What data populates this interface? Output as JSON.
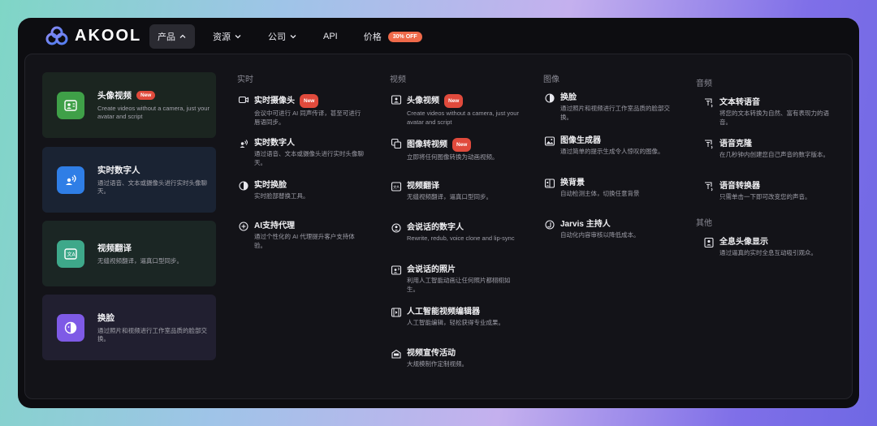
{
  "brand": {
    "name": "AKOOL"
  },
  "nav": {
    "items": [
      {
        "label": "产品",
        "active": true,
        "chevron": true
      },
      {
        "label": "资源",
        "active": false,
        "chevron": true
      },
      {
        "label": "公司",
        "active": false,
        "chevron": true
      },
      {
        "label": "API",
        "active": false,
        "chevron": false
      },
      {
        "label": "价格",
        "active": false,
        "chevron": false
      }
    ],
    "pricing_badge": "30% OFF"
  },
  "feature_cards": [
    {
      "title": "头像视频",
      "badge": "New",
      "desc": "Create videos without a camera, just your avatar and script",
      "color": "#3fa048",
      "bg": "#1b2520",
      "icon": "avatar-video-icon"
    },
    {
      "title": "实时数字人",
      "badge": "",
      "desc": "通过语音、文本或摄像头进行实时头像聊天。",
      "color": "#2f7ee6",
      "bg": "#1a2333",
      "icon": "realtime-avatar-icon"
    },
    {
      "title": "视频翻译",
      "badge": "",
      "desc": "无缝视频翻译，逼真口型同步。",
      "color": "#3ea88a",
      "bg": "#1b2624",
      "icon": "video-translate-icon"
    },
    {
      "title": "换脸",
      "badge": "",
      "desc": "通过照片和视频进行工作室品质的脸部交换。",
      "color": "#7e5ae6",
      "bg": "#211f30",
      "icon": "face-swap-icon"
    }
  ],
  "columns": {
    "realtime": {
      "heading": "实时",
      "items": [
        {
          "title": "实时摄像头",
          "badge": "New",
          "desc": "会议中可进行 AI 同声传译，甚至可进行唇语同步。",
          "icon": "camera-icon"
        },
        {
          "title": "实时数字人",
          "badge": "",
          "desc": "通过语音、文本或摄像头进行实时头像聊天。",
          "icon": "realtime-avatar-icon"
        },
        {
          "title": "实时换脸",
          "badge": "",
          "desc": "实时脸部替换工具。",
          "icon": "face-swap-icon"
        },
        {
          "title": "AI支持代理",
          "badge": "",
          "desc": "通过个性化的 AI 代理提升客户支持体验。",
          "icon": "support-agent-icon"
        }
      ]
    },
    "video": {
      "heading": "视频",
      "items": [
        {
          "title": "头像视频",
          "badge": "New",
          "desc": "Create videos without a camera, just your avatar and script",
          "icon": "avatar-video-icon"
        },
        {
          "title": "图像转视频",
          "badge": "New",
          "desc": "立即将任何图像转换为动画视频。",
          "icon": "image-to-video-icon"
        },
        {
          "title": "视频翻译",
          "badge": "",
          "desc": "无缝视频翻译，逼真口型同步。",
          "icon": "video-translate-icon"
        },
        {
          "title": "会说话的数字人",
          "badge": "",
          "desc": "Rewrite, redub, voice clone and lip-sync",
          "icon": "talking-avatar-icon"
        },
        {
          "title": "会说话的照片",
          "badge": "",
          "desc": "利用人工智能动画让任何照片都栩栩如生。",
          "icon": "talking-photo-icon"
        },
        {
          "title": "人工智能视频编辑器",
          "badge": "",
          "desc": "人工智能编辑，轻松获得专业成果。",
          "icon": "video-editor-icon"
        },
        {
          "title": "视频宣传活动",
          "badge": "",
          "desc": "大规模制作定制视频。",
          "icon": "campaign-icon"
        }
      ]
    },
    "image": {
      "heading": "图像",
      "items": [
        {
          "title": "换脸",
          "badge": "",
          "desc": "通过照片和视频进行工作室品质的脸部交换。",
          "icon": "face-swap-icon"
        },
        {
          "title": "图像生成器",
          "badge": "",
          "desc": "通过简单的提示生成令人惊叹的图像。",
          "icon": "image-generator-icon"
        },
        {
          "title": "换背景",
          "badge": "",
          "desc": "自动检测主体，切换任意背景",
          "icon": "background-change-icon"
        },
        {
          "title": "Jarvis 主持人",
          "badge": "",
          "desc": "自动化内容审核以降低成本。",
          "icon": "jarvis-icon"
        }
      ]
    },
    "audio": {
      "heading": "音频",
      "items": [
        {
          "title": "文本转语音",
          "badge": "",
          "desc": "将您的文本转换为自然、富有表现力的语音。",
          "icon": "text-to-speech-icon"
        },
        {
          "title": "语音克隆",
          "badge": "",
          "desc": "在几秒钟内创建您自己声音的数字版本。",
          "icon": "voice-clone-icon"
        },
        {
          "title": "语音转换器",
          "badge": "",
          "desc": "只需单击一下即可改变您的声音。",
          "icon": "voice-changer-icon"
        }
      ]
    },
    "other": {
      "heading": "其他",
      "items": [
        {
          "title": "全息头像显示",
          "badge": "",
          "desc": "通过逼真的实时全息互动吸引观众。",
          "icon": "hologram-icon"
        }
      ]
    }
  }
}
